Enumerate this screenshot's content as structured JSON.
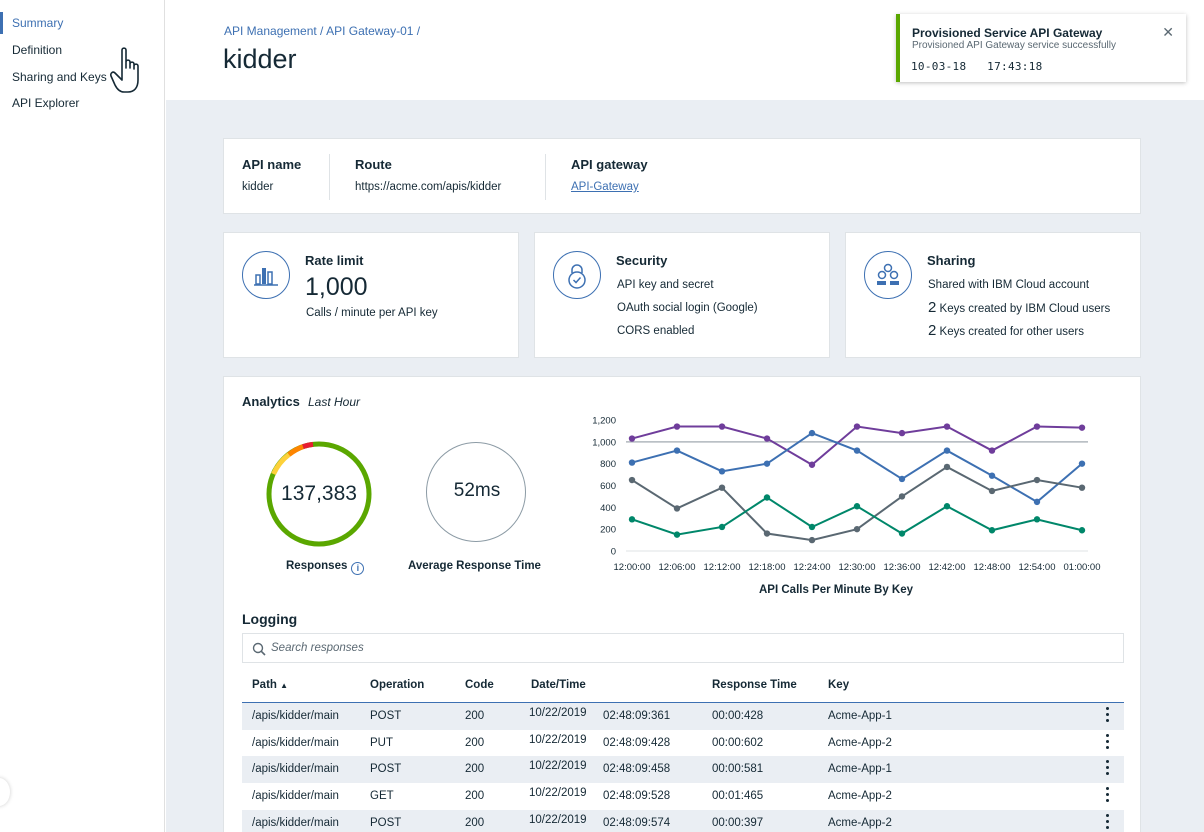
{
  "sidebar": {
    "items": [
      {
        "label": "Summary",
        "active": true
      },
      {
        "label": "Definition"
      },
      {
        "label": "Sharing and Keys"
      },
      {
        "label": "API Explorer"
      }
    ]
  },
  "header": {
    "breadcrumb": [
      "API Management /",
      "API Gateway-01 /"
    ],
    "title": "kidder"
  },
  "toast": {
    "title": "Provisioned Service API Gateway",
    "subtitle": "Provisioned API Gateway service successfully",
    "date": "10-03-18",
    "time": "17:43:18",
    "status_color": "#5aa700"
  },
  "info": {
    "api_name_label": "API name",
    "api_name_value": "kidder",
    "route_label": "Route",
    "route_value": "https://acme.com/apis/kidder",
    "gateway_label": "API gateway",
    "gateway_value": "API-Gateway"
  },
  "rate_limit": {
    "title": "Rate limit",
    "value": "1,000",
    "unit": "Calls / minute per API key",
    "icon": "bar-chart-icon"
  },
  "security": {
    "title": "Security",
    "lines": [
      "API key and secret",
      "OAuth social login (Google)",
      "CORS enabled"
    ],
    "icon": "lock-icon"
  },
  "sharing": {
    "title": "Sharing",
    "line1": "Shared with IBM Cloud account",
    "count1": "2",
    "line2": "Keys created by IBM Cloud users",
    "count2": "2",
    "line3": "Keys created for other users",
    "icon": "users-icon"
  },
  "analytics": {
    "title": "Analytics",
    "period": "Last Hour",
    "responses_value": "137,383",
    "responses_label": "Responses",
    "avg_response_value": "52ms",
    "avg_response_label": "Average Response Time",
    "chart_title": "API Calls Per Minute By Key"
  },
  "chart_data": {
    "type": "line",
    "title": "API Calls Per Minute By Key",
    "xlabel": "",
    "ylabel": "",
    "x": [
      "12:00:00",
      "12:06:00",
      "12:12:00",
      "12:18:00",
      "12:24:00",
      "12:30:00",
      "12:36:00",
      "12:42:00",
      "12:48:00",
      "12:54:00",
      "01:00:00"
    ],
    "yticks": [
      "0",
      "200",
      "400",
      "600",
      "800",
      "1,000",
      "1,200"
    ],
    "ylim": [
      0,
      1200
    ],
    "reference_line": 1000,
    "grid": false,
    "series": [
      {
        "color": "#6f3d9b",
        "values": [
          1030,
          1140,
          1140,
          1030,
          790,
          1140,
          1080,
          1140,
          920,
          1140,
          1130
        ]
      },
      {
        "color": "#3d70b2",
        "values": [
          810,
          920,
          730,
          800,
          1080,
          920,
          660,
          920,
          690,
          450,
          800
        ]
      },
      {
        "color": "#5a6872",
        "values": [
          650,
          390,
          580,
          160,
          100,
          200,
          500,
          770,
          550,
          650,
          580
        ]
      },
      {
        "color": "#00876a",
        "values": [
          290,
          150,
          220,
          490,
          220,
          410,
          160,
          410,
          190,
          290,
          190
        ]
      }
    ]
  },
  "logging": {
    "title": "Logging",
    "search_placeholder": "Search responses",
    "columns": [
      "Path",
      "Operation",
      "Code",
      "Date/Time",
      "Response Time",
      "Key"
    ],
    "rows": [
      {
        "path": "/apis/kidder/main",
        "op": "POST",
        "code": "200",
        "date": "10/22/2019",
        "time": "02:48:09:361",
        "rt": "00:00:428",
        "key": "Acme-App-1"
      },
      {
        "path": "/apis/kidder/main",
        "op": "PUT",
        "code": "200",
        "date": "10/22/2019",
        "time": "02:48:09:428",
        "rt": "00:00:602",
        "key": "Acme-App-2"
      },
      {
        "path": "/apis/kidder/main",
        "op": "POST",
        "code": "200",
        "date": "10/22/2019",
        "time": "02:48:09:458",
        "rt": "00:00:581",
        "key": "Acme-App-1"
      },
      {
        "path": "/apis/kidder/main",
        "op": "GET",
        "code": "200",
        "date": "10/22/2019",
        "time": "02:48:09:528",
        "rt": "00:01:465",
        "key": "Acme-App-2"
      },
      {
        "path": "/apis/kidder/main",
        "op": "POST",
        "code": "200",
        "date": "10/22/2019",
        "time": "02:48:09:574",
        "rt": "00:00:397",
        "key": "Acme-App-2"
      }
    ]
  }
}
